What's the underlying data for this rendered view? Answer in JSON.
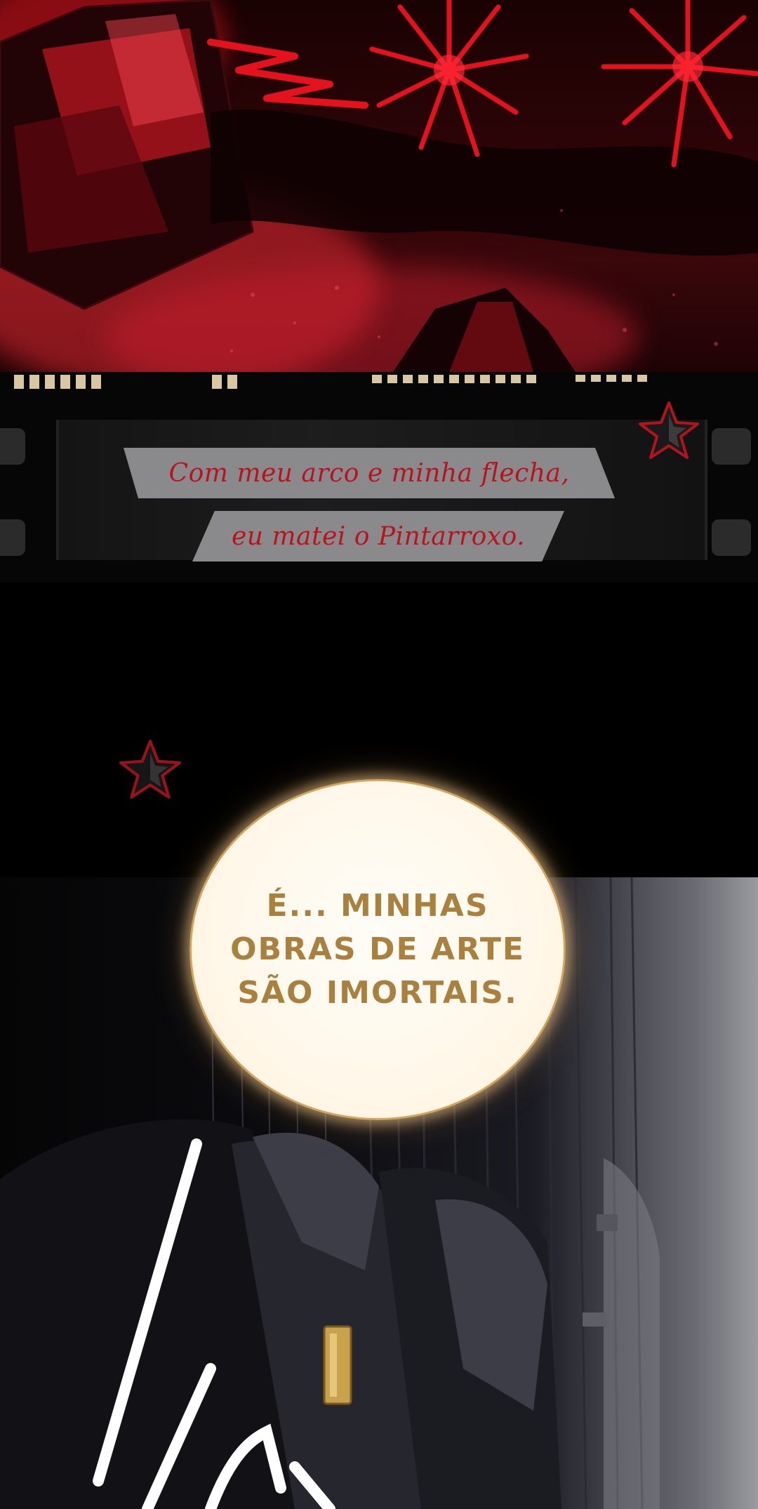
{
  "caption": {
    "line1": "Com meu arco e minha flecha,",
    "line2": "eu matei o Pintarroxo."
  },
  "speech_bubble": {
    "line1": "É... MINHAS",
    "line2": "OBRAS DE ARTE",
    "line3": "SÃO IMORTAIS."
  },
  "colors": {
    "explosion_red": "#e3121c",
    "caption_band": "#8a8a8c",
    "caption_text": "#b8141e",
    "bubble_text": "#a9803e",
    "bubble_glow": "#f2d9b0",
    "film_hole": "#d9c6a3"
  },
  "icons": [
    "star-icon",
    "star-icon"
  ]
}
